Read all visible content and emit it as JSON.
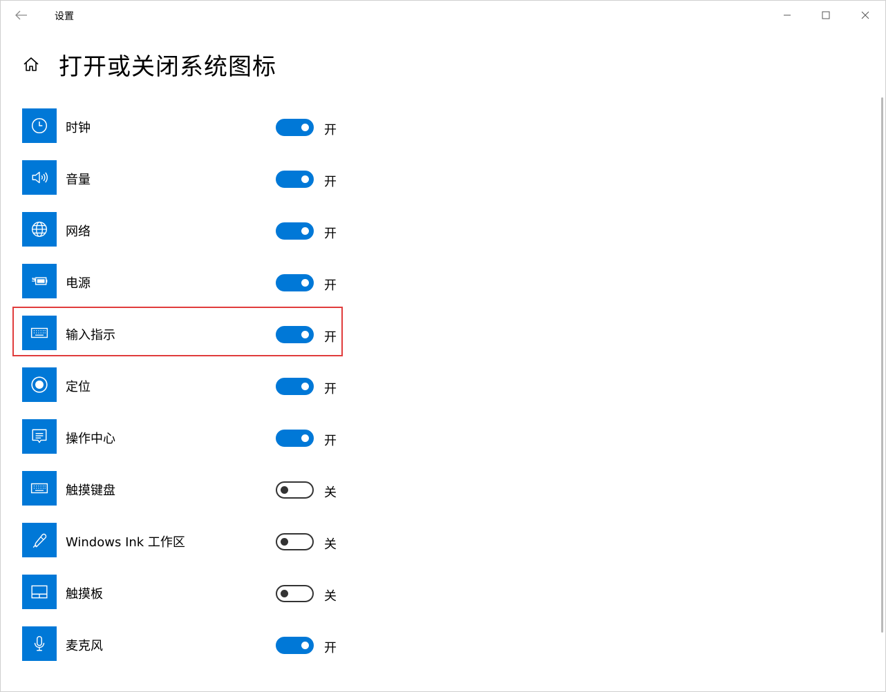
{
  "window": {
    "title": "设置"
  },
  "page": {
    "title": "打开或关闭系统图标"
  },
  "items": [
    {
      "label": "时钟",
      "icon": "clock-icon",
      "state": "开",
      "on": true
    },
    {
      "label": "音量",
      "icon": "volume-icon",
      "state": "开",
      "on": true
    },
    {
      "label": "网络",
      "icon": "globe-icon",
      "state": "开",
      "on": true
    },
    {
      "label": "电源",
      "icon": "battery-icon",
      "state": "开",
      "on": true
    },
    {
      "label": "输入指示",
      "icon": "keyboard-icon",
      "state": "开",
      "on": true
    },
    {
      "label": "定位",
      "icon": "location-icon",
      "state": "开",
      "on": true
    },
    {
      "label": "操作中心",
      "icon": "action-center-icon",
      "state": "开",
      "on": true
    },
    {
      "label": "触摸键盘",
      "icon": "keyboard-icon",
      "state": "关",
      "on": false
    },
    {
      "label": "Windows Ink 工作区",
      "icon": "pen-icon",
      "state": "关",
      "on": false
    },
    {
      "label": "触摸板",
      "icon": "touchpad-icon",
      "state": "关",
      "on": false
    },
    {
      "label": "麦克风",
      "icon": "microphone-icon",
      "state": "开",
      "on": true
    }
  ],
  "colors": {
    "accent": "#0078d7",
    "highlight": "#e03c3c"
  }
}
